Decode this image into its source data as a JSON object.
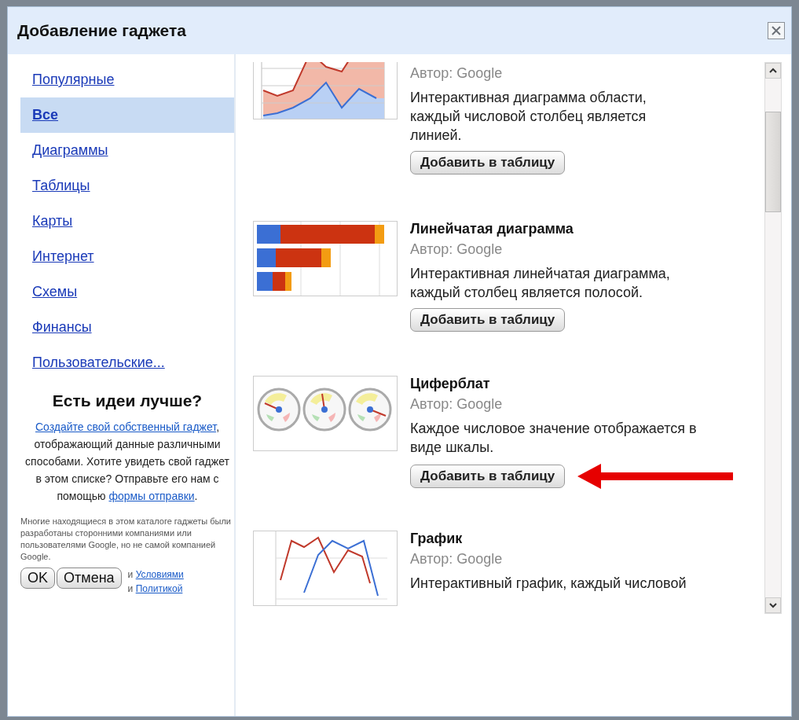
{
  "dialog": {
    "title": "Добавление гаджета"
  },
  "sidebar": {
    "categories": [
      {
        "label": "Популярные",
        "selected": false
      },
      {
        "label": "Все",
        "selected": true
      },
      {
        "label": "Диаграммы",
        "selected": false
      },
      {
        "label": "Таблицы",
        "selected": false
      },
      {
        "label": "Карты",
        "selected": false
      },
      {
        "label": "Интернет",
        "selected": false
      },
      {
        "label": "Схемы",
        "selected": false
      },
      {
        "label": "Финансы",
        "selected": false
      },
      {
        "label": "Пользовательские...",
        "selected": false
      }
    ],
    "ideas": {
      "heading": "Есть идеи лучше?",
      "parts": [
        {
          "kind": "link",
          "text": "Создайте свой собственный гаджет"
        },
        {
          "kind": "text",
          "text": ", отображающий данные различными способами. Хотите увидеть свой гаджет в этом списке? Отправьте его нам с помощью "
        },
        {
          "kind": "link",
          "text": "формы отправки"
        },
        {
          "kind": "text",
          "text": "."
        }
      ]
    },
    "disclaimer": "Многие находящиеся в этом каталоге гаджеты были разработаны сторонними компаниями или пользователями Google, но не самой компанией Google.",
    "terms_lines": [
      [
        {
          "kind": "text",
          "text": "и "
        },
        {
          "kind": "link",
          "text": "Условиями"
        }
      ],
      [
        {
          "kind": "text",
          "text": "и "
        },
        {
          "kind": "link",
          "text": "Политикой"
        }
      ]
    ]
  },
  "gadgets": [
    {
      "kind": "area",
      "author": "Автор: Google",
      "description": "Интерактивная диаграмма области, каждый числовой столбец является линией.",
      "button": "Добавить в таблицу",
      "pointer": false
    },
    {
      "kind": "bar",
      "title": "Линейчатая диаграмма",
      "author": "Автор: Google",
      "description": "Интерактивная линейчатая диаграмма, каждый столбец является полосой.",
      "button": "Добавить в таблицу",
      "pointer": false
    },
    {
      "kind": "gauge",
      "title": "Циферблат",
      "author": "Автор: Google",
      "description": "Каждое числовое значение отображается в виде шкалы.",
      "button": "Добавить в таблицу",
      "pointer": true
    },
    {
      "kind": "line",
      "title": "График",
      "author": "Автор: Google",
      "description": "Интерактивный график, каждый числовой",
      "pointer": false
    }
  ],
  "buttons": [
    {
      "label": "OK"
    },
    {
      "label": "Отмена"
    }
  ]
}
